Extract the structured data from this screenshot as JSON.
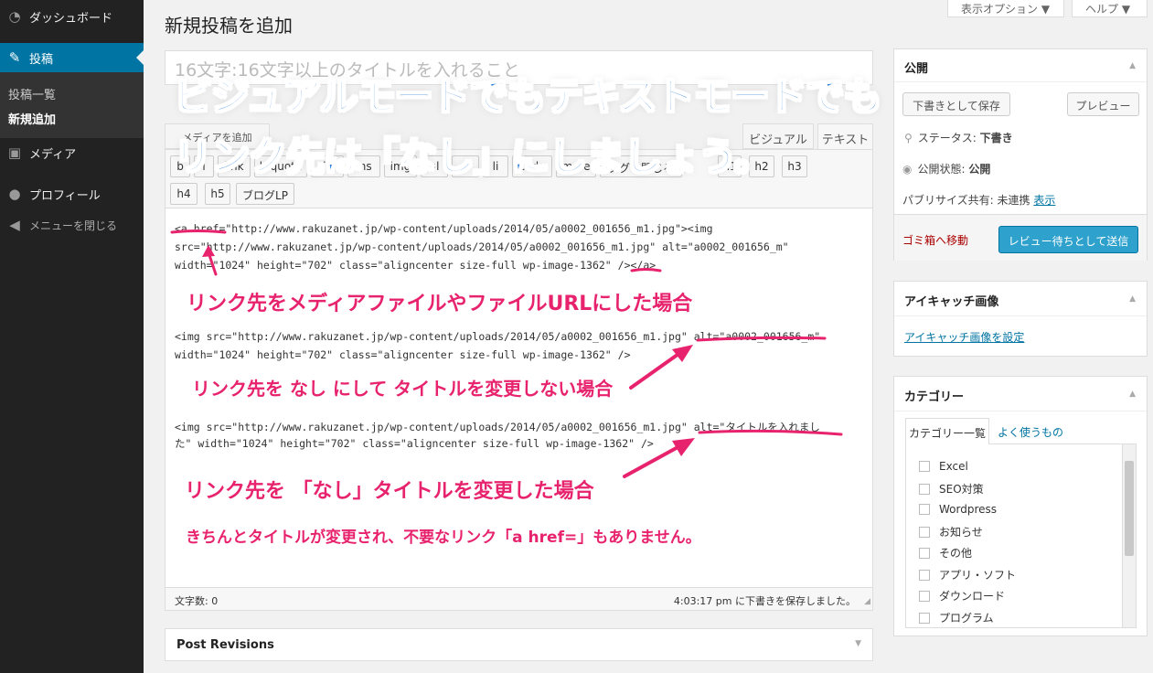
{
  "sidebar": {
    "items": [
      {
        "label": "ダッシュボード",
        "icon": "dashboard-icon"
      },
      {
        "label": "投稿",
        "icon": "pin-icon"
      },
      {
        "label": "メディア",
        "icon": "media-icon"
      },
      {
        "label": "プロフィール",
        "icon": "user-icon"
      },
      {
        "label": "メニューを閉じる",
        "icon": "collapse-icon"
      }
    ],
    "submenu": [
      {
        "label": "投稿一覧"
      },
      {
        "label": "新規追加"
      }
    ]
  },
  "header": {
    "title": "新規投稿を追加",
    "screen_options": "表示オプション ▼",
    "help": "ヘルプ ▼"
  },
  "title_input": {
    "value": "16文字:16文字以上のタイトルを入れること"
  },
  "editor": {
    "upload_label": "メディアを追加",
    "tab_visual": "ビジュアル",
    "tab_text": "テキスト",
    "quicktags": [
      "b",
      "i",
      "link",
      "b-quote",
      "del",
      "ins",
      "img",
      "ul",
      "ol",
      "li",
      "code",
      "more",
      "タグを閉じる",
      "h1",
      "h2",
      "h3",
      "h4",
      "h5",
      "ブログLP"
    ],
    "code_lines": [
      "<a href=\"http://www.rakuzanet.jp/wp-content/uploads/2014/05/a0002_001656_m1.jpg\"><img",
      "src=\"http://www.rakuzanet.jp/wp-content/uploads/2014/05/a0002_001656_m1.jpg\" alt=\"a0002_001656_m\"",
      "width=\"1024\" height=\"702\" class=\"aligncenter size-full wp-image-1362\" /></a>",
      "<img src=\"http://www.rakuzanet.jp/wp-content/uploads/2014/05/a0002_001656_m1.jpg\" alt=\"a0002_001656_m\"",
      "width=\"1024\" height=\"702\" class=\"aligncenter size-full wp-image-1362\" />",
      "<img src=\"http://www.rakuzanet.jp/wp-content/uploads/2014/05/a0002_001656_m1.jpg\" alt=\"タイトルを入れまし",
      "た\" width=\"1024\" height=\"702\" class=\"aligncenter size-full wp-image-1362\" />"
    ],
    "word_count": "文字数: 0",
    "autosave": "4:03:17 pm に下書きを保存しました。"
  },
  "revisions": {
    "title": "Post Revisions"
  },
  "publish_box": {
    "title": "公開",
    "save_draft": "下書きとして保存",
    "preview": "プレビュー",
    "status_label": "ステータス:",
    "status_value": "下書き",
    "visibility_label": "公開状態:",
    "visibility_value": "公開",
    "publicize_label": "パブリサイズ共有: 未連携",
    "publicize_link": "表示",
    "trash": "ゴミ箱へ移動",
    "submit": "レビュー待ちとして送信"
  },
  "featured_image_box": {
    "title": "アイキャッチ画像",
    "link": "アイキャッチ画像を設定"
  },
  "category_box": {
    "title": "カテゴリー",
    "tab_all": "カテゴリー一覧",
    "tab_popular": "よく使うもの",
    "items": [
      "Excel",
      "SEO対策",
      "Wordpress",
      "お知らせ",
      "その他",
      "アプリ・ソフト",
      "ダウンロード",
      "プログラム"
    ]
  },
  "overlay": {
    "banner_line1": "ビジュアルモードでもテキストモードでも",
    "banner_line2": "リンク先は「なし」にしましょう。",
    "note1": "リンク先をメディアファイルやファイルURLにした場合",
    "note2": "リンク先を なし にして タイトルを変更しない場合",
    "note3": "リンク先を 「なし」タイトルを変更した場合",
    "note4": "きちんとタイトルが変更され、不要なリンク「a href=」もありません。"
  },
  "colors": {
    "sidebar_bg": "#222222",
    "active_menu": "#0074a2",
    "banner_blue": "#2d7fd8",
    "annotation_pink": "#e8236e",
    "primary_button": "#2ea2cc",
    "trash_red": "#a00000"
  }
}
